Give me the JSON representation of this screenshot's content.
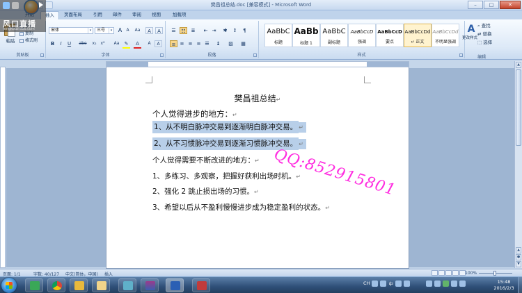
{
  "window": {
    "title": "樊昌祖总结.doc [兼容模式] - Microsoft Word",
    "minimize": "–",
    "maximize": "□",
    "close": "✕"
  },
  "overlay_logo": {
    "brand": "风口直播",
    "sub": "fengkouzhibo.com"
  },
  "tabs": [
    "开始",
    "插入",
    "页面布局",
    "引用",
    "邮件",
    "审阅",
    "视图",
    "加载项"
  ],
  "active_tab": "开始",
  "clipboard": {
    "paste": "粘贴",
    "cut": "剪切",
    "copy": "复制",
    "format_painter": "格式刷",
    "label": "剪贴板"
  },
  "font": {
    "name": "宋体",
    "size": "三号",
    "label": "字体",
    "bold": "B",
    "italic": "I",
    "underline": "U",
    "strike": "abe",
    "sub": "x₂",
    "sup": "x²",
    "aa": "Aa",
    "grow": "A",
    "shrink": "A",
    "clear": "A",
    "color_a": "A",
    "highlight_color": "#ffff00",
    "font_color": "#e02020"
  },
  "paragraph": {
    "label": "段落"
  },
  "styles": {
    "label": "样式",
    "items": [
      {
        "sample": "AaBbC",
        "name": "标题"
      },
      {
        "sample": "AaBb",
        "name": "标题 1"
      },
      {
        "sample": "AaBbC",
        "name": "副标题"
      },
      {
        "sample": "AaBbCcD",
        "name": "强调"
      },
      {
        "sample": "AaBbCcD",
        "name": "要点"
      },
      {
        "sample": "AaBbCcDd",
        "name": "↵ 正文"
      },
      {
        "sample": "AaBbCcDd",
        "name": "不明显强调"
      }
    ],
    "change_styles": "更改样式"
  },
  "editing": {
    "find": "查找",
    "replace": "替换",
    "select": "选择",
    "label": "编辑"
  },
  "document": {
    "title": "樊昌祖总结",
    "lines": [
      "个人觉得进步的地方：",
      "1、从不明白脉冲交易到逐渐明白脉冲交易。",
      "2、从不习惯脉冲交易到逐渐习惯脉冲交易。",
      "个人觉得需要不断改进的地方：",
      "1、多练习、多观察，把握好获利出场时机。",
      "2、强化 2 跳止损出场的习惯。",
      "3、希望以后从不盈利慢慢进步成为稳定盈利的状态。"
    ],
    "para_mark": "↵"
  },
  "watermark": "QQ:852915801",
  "status": {
    "page": "页面: 1/1",
    "words": "字数: 40/127",
    "lang": "中文(简体，中国)",
    "insert": "插入",
    "zoom": "100%"
  },
  "tray": {
    "ime": "CH",
    "ime2": "中"
  },
  "clock": {
    "time": "15:48",
    "date": "2016/2/3"
  }
}
